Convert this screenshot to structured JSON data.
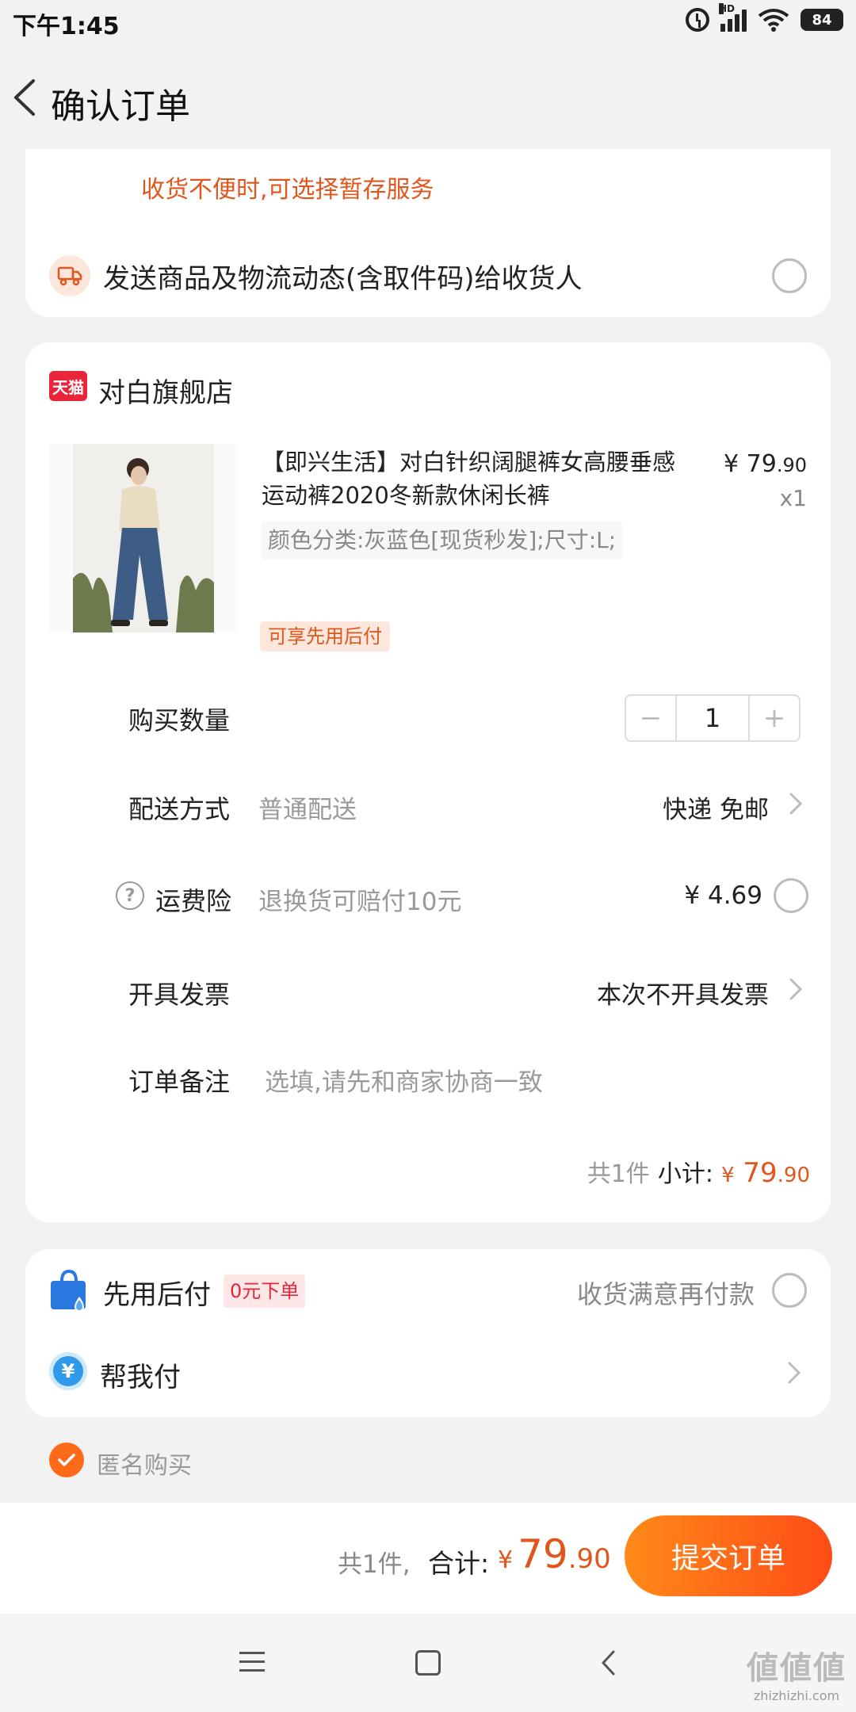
{
  "status_bar": {
    "time": "下午1:45",
    "hd_label": "HD",
    "battery": "84"
  },
  "header": {
    "title": "确认订单"
  },
  "delivery_options": {
    "hold_notice": "收货不便时,可选择暂存服务",
    "send_info_label": "发送商品及物流动态(含取件码)给收货人"
  },
  "store": {
    "badge": "天猫",
    "name": "对白旗舰店"
  },
  "product": {
    "title": "【即兴生活】对白针织阔腿裤女高腰垂感运动裤2020冬新款休闲长裤",
    "price_symbol": "¥",
    "price_int": "79",
    "price_dec": ".90",
    "quantity_label": "x1",
    "spec": "颜色分类:灰蓝色[现货秒发];尺寸:L;",
    "tag": "可享先用后付"
  },
  "quantity": {
    "label": "购买数量",
    "minus": "−",
    "value": "1",
    "plus": "+"
  },
  "shipping": {
    "label": "配送方式",
    "sub": "普通配送",
    "value": "快递 免邮"
  },
  "insurance": {
    "label": "运费险",
    "sub": "退换货可赔付10元",
    "value": "¥ 4.69"
  },
  "invoice": {
    "label": "开具发票",
    "value": "本次不开具发票"
  },
  "note": {
    "label": "订单备注",
    "placeholder": "选填,请先和商家协商一致"
  },
  "subtotal": {
    "count": "共1件",
    "label": "小计:",
    "symbol": "¥",
    "int": "79",
    "dec": ".90"
  },
  "payment": {
    "pay_later_title": "先用后付",
    "pay_later_tag": "0元下单",
    "pay_later_desc": "收货满意再付款",
    "help_pay_label": "帮我付",
    "help_pay_icon_text": "¥"
  },
  "anonymous": {
    "label": "匿名购买"
  },
  "bottom_bar": {
    "count": "共1件,",
    "total_label": "合计:",
    "symbol": "¥",
    "int": "79",
    "dec": ".90",
    "submit": "提交订单"
  },
  "watermark": {
    "glyphs": "値値値",
    "url": "zhizhizhi.com"
  },
  "colors": {
    "accent": "#ff6a1a",
    "price": "#e0561d",
    "tmall": "#e8253a"
  }
}
